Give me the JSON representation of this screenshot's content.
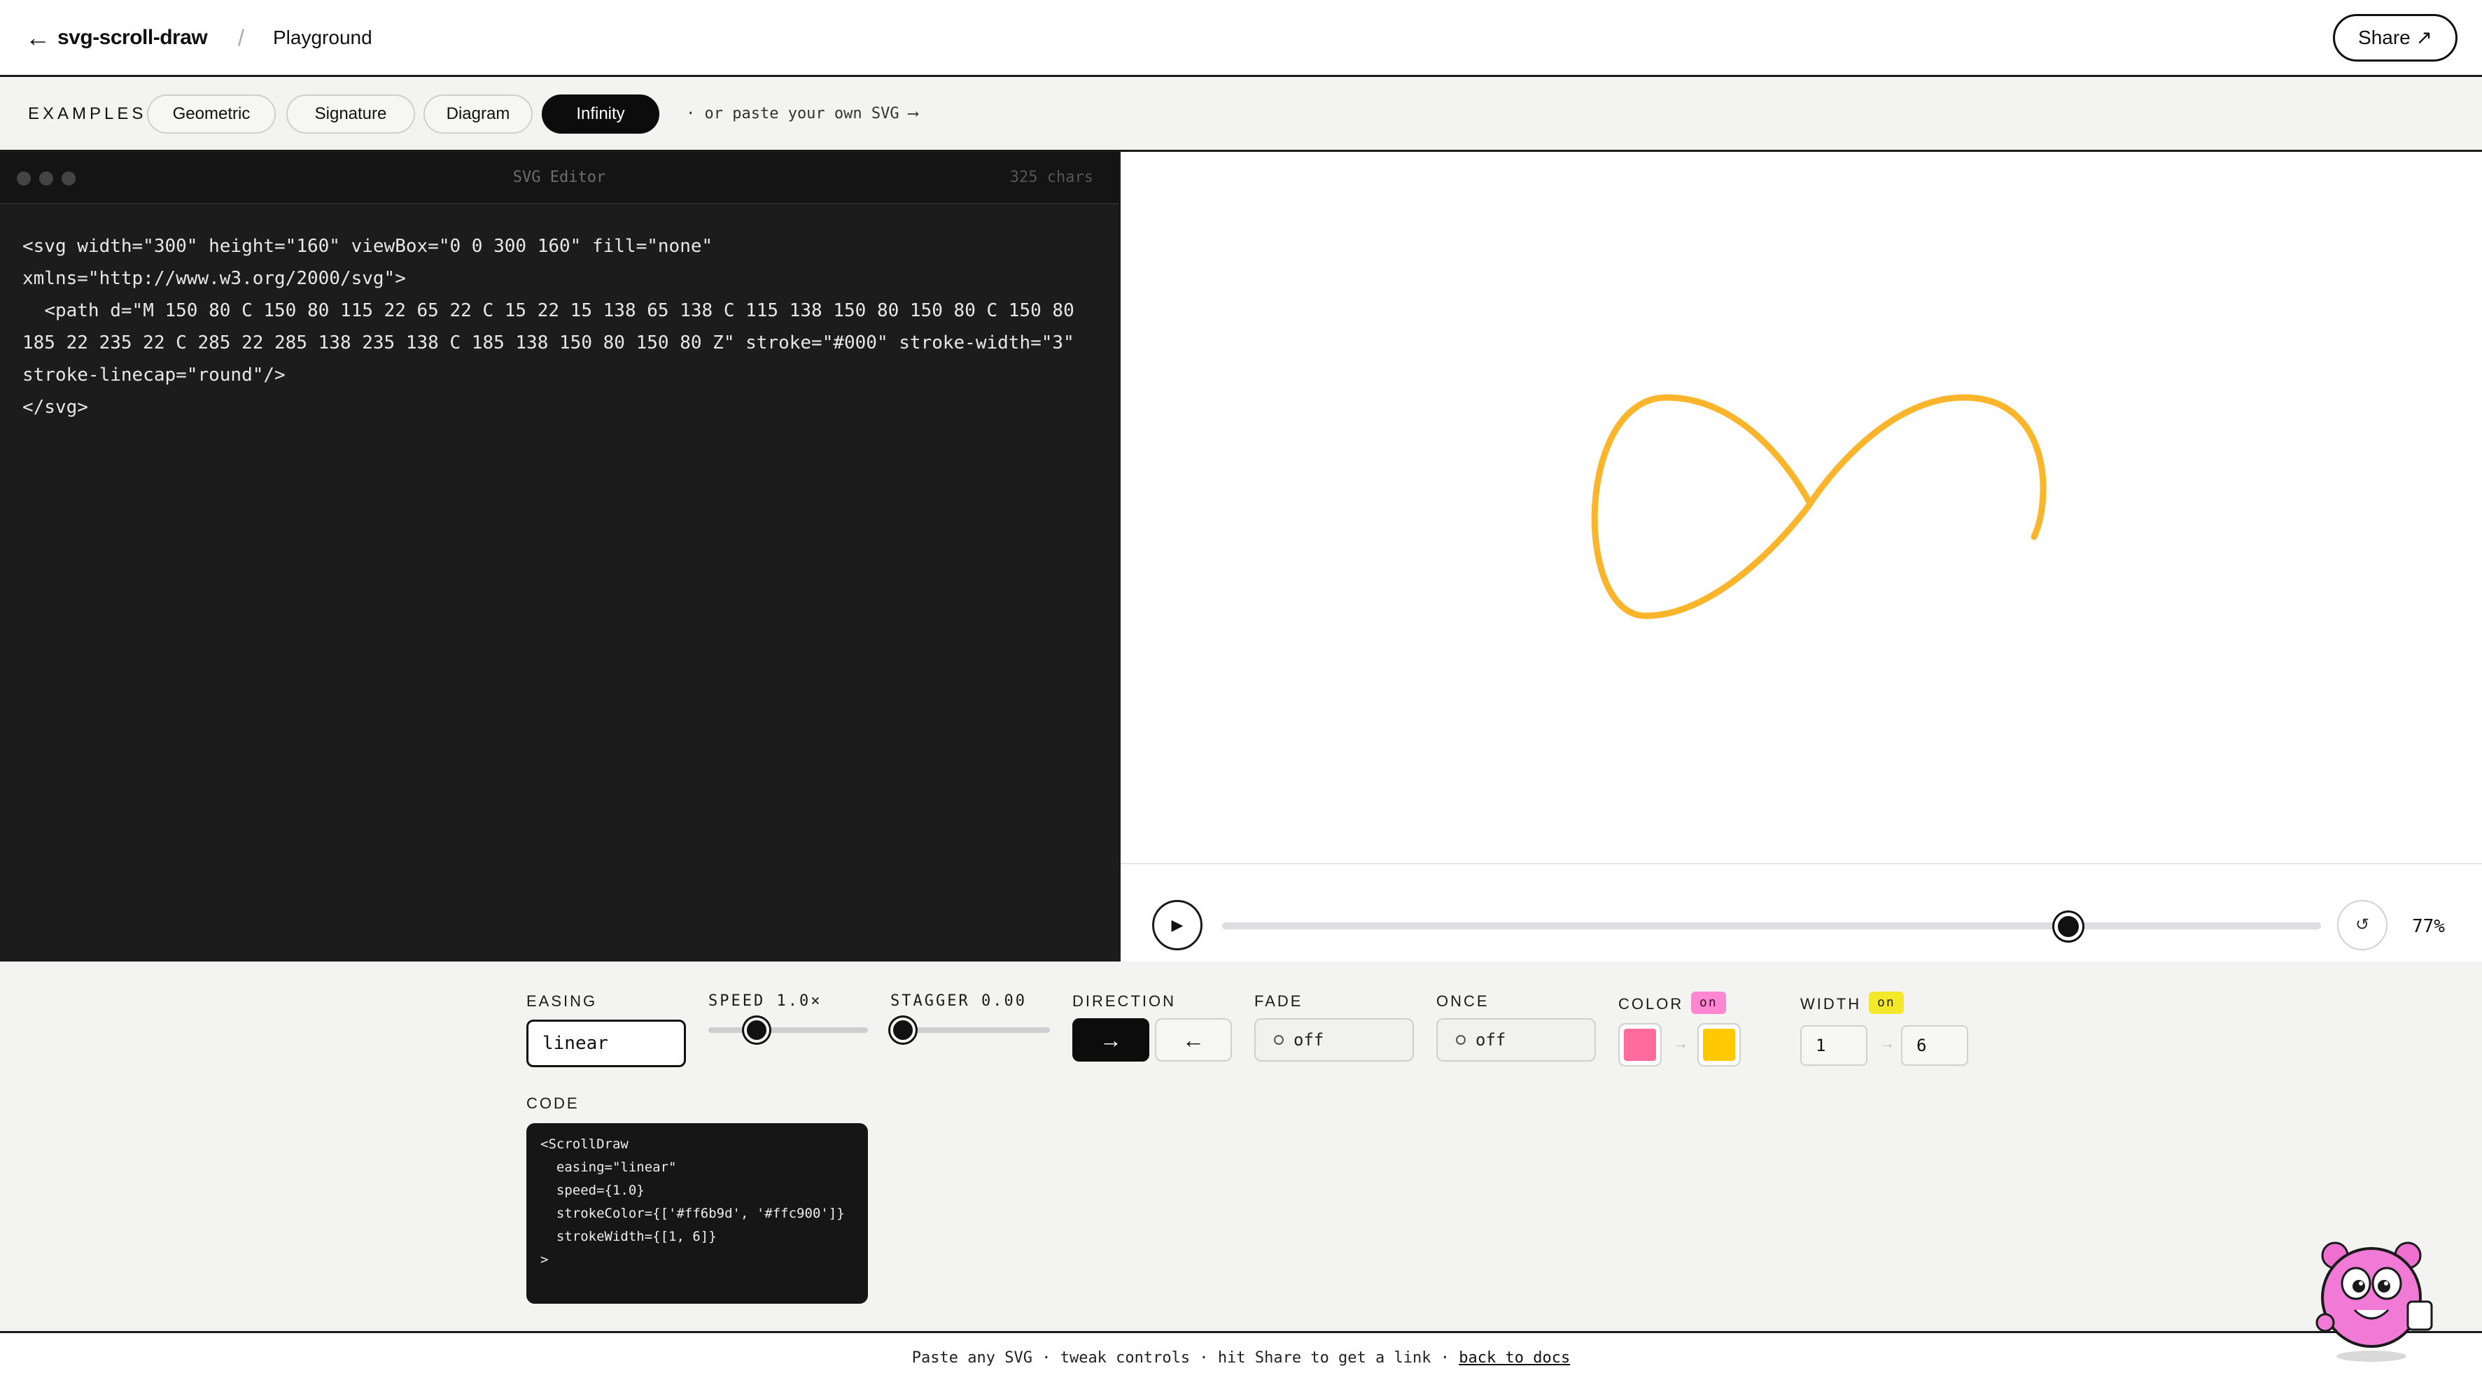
{
  "header": {
    "back_icon": "arrow-left-icon",
    "brand": "svg-scroll-draw",
    "separator": "/",
    "page": "Playground",
    "share_label": "Share ↗"
  },
  "examples": {
    "label": "EXAMPLES",
    "items": [
      "Geometric",
      "Signature",
      "Diagram",
      "Infinity"
    ],
    "active": "Infinity",
    "paste_hint": "· or paste your own SVG ⟶"
  },
  "editor": {
    "title": "SVG Editor",
    "char_count": "325 chars",
    "code": "<svg width=\"300\" height=\"160\" viewBox=\"0 0 300 160\" fill=\"none\"\nxmlns=\"http://www.w3.org/2000/svg\">\n  <path d=\"M 150 80 C 150 80 115 22 65 22 C 15 22 15 138 65 138 C 115 138 150 80 150 80 C 150 80\n185 22 235 22 C 285 22 285 138 235 138 C 185 138 150 80 150 80 Z\" stroke=\"#000\" stroke-width=\"3\"\nstroke-linecap=\"round\"/>\n</svg>"
  },
  "preview": {
    "stroke_color": "#fbb52a",
    "play_icon": "▶",
    "reset_icon": "↺",
    "progress": 0.77,
    "progress_label": "77%"
  },
  "controls": {
    "easing": {
      "label": "EASING",
      "value": "linear"
    },
    "speed": {
      "label": "SPEED 1.0×",
      "value": 1.0
    },
    "stagger": {
      "label": "STAGGER 0.00",
      "value": 0.0
    },
    "direction": {
      "label": "DIRECTION",
      "forward": "→",
      "backward": "←",
      "selected": "forward"
    },
    "fade": {
      "label": "FADE",
      "value": "off"
    },
    "once": {
      "label": "ONCE",
      "value": "off"
    },
    "color": {
      "label": "COLOR",
      "badge": "on",
      "from": "#ff6b9d",
      "to": "#ffc900",
      "arrow": "→"
    },
    "width": {
      "label": "WIDTH",
      "badge": "on",
      "from": "1",
      "to": "6",
      "arrow": "→"
    },
    "code": {
      "label": "CODE",
      "snippet": "<ScrollDraw\n  easing=\"linear\"\n  speed={1.0}\n  strokeColor={['#ff6b9d', '#ffc900']}\n  strokeWidth={[1, 6]}\n>"
    }
  },
  "footer": {
    "text": "Paste any SVG · tweak controls · hit Share to get a link · ",
    "link": "back to docs"
  }
}
